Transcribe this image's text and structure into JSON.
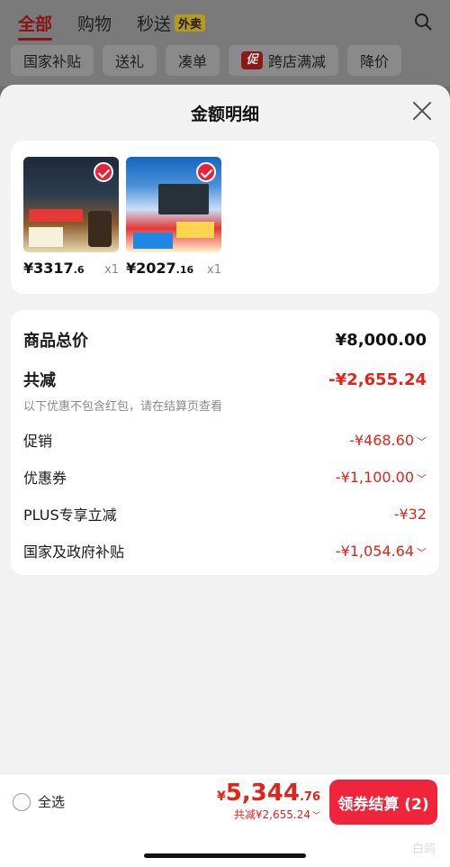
{
  "header": {
    "tabs": [
      {
        "label": "全部",
        "active": true
      },
      {
        "label": "购物"
      },
      {
        "label": "秒送",
        "badge": "外卖"
      }
    ],
    "chips": [
      "国家补贴",
      "送礼",
      "凑单",
      "跨店满减",
      "降价"
    ],
    "promo_badge": "促"
  },
  "sheet": {
    "title": "金额明细",
    "products": [
      {
        "price_main": "¥3317",
        "price_dec": ".6",
        "qty": "x1"
      },
      {
        "price_main": "¥2027",
        "price_dec": ".16",
        "qty": "x1"
      }
    ],
    "summary": {
      "total_label": "商品总价",
      "total_value": "¥8,000.00",
      "discount_label": "共减",
      "discount_value": "-¥2,655.24",
      "note": "以下优惠不包含红包，请在结算页查看",
      "items": [
        {
          "label": "促销",
          "value": "-¥468.60"
        },
        {
          "label": "优惠券",
          "value": "-¥1,100.00"
        },
        {
          "label": "PLUS专享立减",
          "value": "-¥32"
        },
        {
          "label": "国家及政府补贴",
          "value": "-¥1,054.64"
        }
      ]
    }
  },
  "bottom": {
    "select_all": "全选",
    "yen": "¥",
    "amount_main": "5,344",
    "amount_dec": ".76",
    "discount_text": "共减¥2,655.24",
    "checkout_label": "领券结算 (2)",
    "watermark": "白鸽"
  },
  "colors": {
    "accent": "#f0253c",
    "price_red": "#e2231a"
  }
}
